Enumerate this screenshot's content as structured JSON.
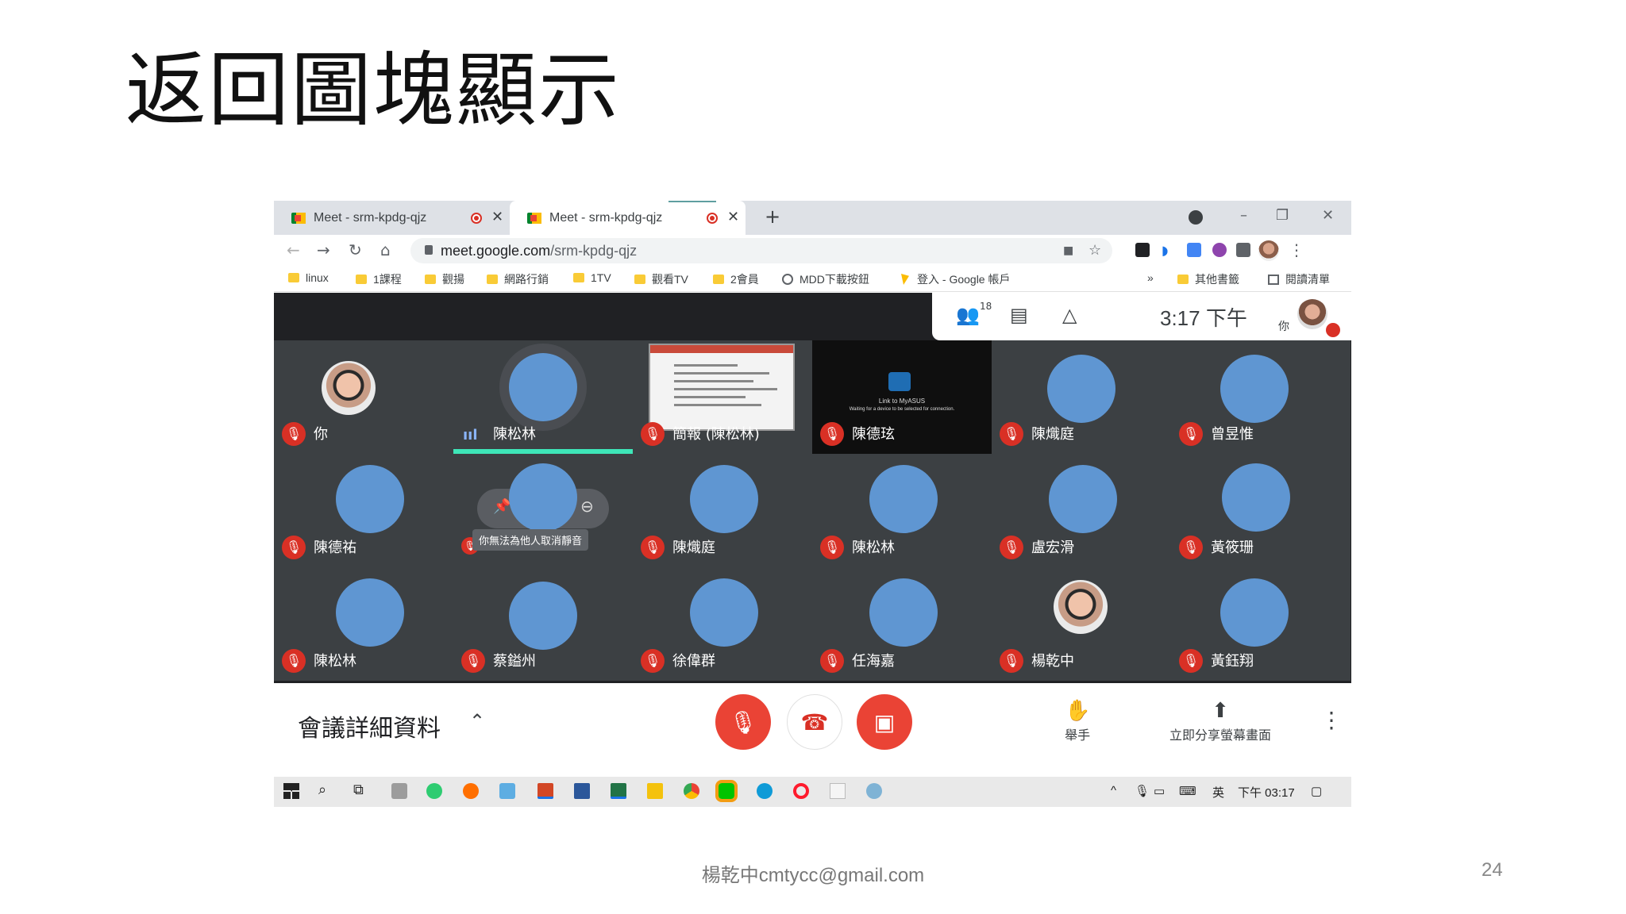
{
  "slide": {
    "title": "返回圖塊顯示",
    "footer": "楊乾中cmtycc@gmail.com",
    "page_number": "24"
  },
  "browser": {
    "tabs": [
      {
        "label": "Meet - srm-kpdg-qjz",
        "recording": true
      },
      {
        "label": "Meet - srm-kpdg-qjz",
        "recording": true,
        "active": true
      }
    ],
    "new_tab": "+",
    "window_controls": {
      "minimize": "–",
      "restore": "❐",
      "close": "✕"
    },
    "url_host": "meet.google.com",
    "url_path": "/srm-kpdg-qjz",
    "bookmarks": [
      {
        "label": "linux",
        "icon": "folder-icon"
      },
      {
        "label": "1課程",
        "icon": "folder-icon"
      },
      {
        "label": "觀揚",
        "icon": "folder-icon"
      },
      {
        "label": "網路行銷",
        "icon": "folder-icon"
      },
      {
        "label": "1TV",
        "icon": "folder-icon"
      },
      {
        "label": "觀看TV",
        "icon": "folder-icon"
      },
      {
        "label": "2會員",
        "icon": "folder-icon"
      },
      {
        "label": "MDD下載按鈕",
        "icon": "globe-icon"
      },
      {
        "label": "登入 - Google 帳戶",
        "icon": "google-ads-icon"
      }
    ],
    "bookmarks_overflow": "»",
    "other_bookmarks": "其他書籤",
    "reading_list": "閱讀清單"
  },
  "meet": {
    "participant_count": "18",
    "clock": "3:17 下午",
    "self_label": "你",
    "tiles": [
      {
        "name": "你",
        "type": "photo"
      },
      {
        "name": "陳松林",
        "type": "speaking"
      },
      {
        "name": "簡報 (陳松林)",
        "type": "screenshare"
      },
      {
        "name": "陳德玹",
        "type": "myasus"
      },
      {
        "name": "陳熾庭",
        "type": "bubble"
      },
      {
        "name": "曾昱惟",
        "type": "bubble"
      },
      {
        "name": "陳德祐",
        "type": "bubble"
      },
      {
        "name": "",
        "type": "pinned",
        "tooltip": "你無法為他人取消靜音"
      },
      {
        "name": "陳熾庭",
        "type": "bubble"
      },
      {
        "name": "陳松林",
        "type": "bubble"
      },
      {
        "name": "盧宏滑",
        "type": "bubble"
      },
      {
        "name": "黃筱珊",
        "type": "bubble"
      },
      {
        "name": "陳松林",
        "type": "bubble"
      },
      {
        "name": "蔡鎰州",
        "type": "bubble"
      },
      {
        "name": "徐偉群",
        "type": "bubble"
      },
      {
        "name": "任海嘉",
        "type": "bubble"
      },
      {
        "name": "楊乾中",
        "type": "photo"
      },
      {
        "name": "黃鈺翔",
        "type": "bubble"
      }
    ],
    "myasus_text": "Link to MyASUS",
    "myasus_sub": "Waiting for a device to be selected for connection."
  },
  "controls": {
    "meeting_details": "會議詳細資料",
    "raise_hand": "舉手",
    "present_now": "立即分享螢幕畫面"
  },
  "taskbar": {
    "ime": "英",
    "time": "下午 03:17"
  },
  "colors": {
    "meet_bg": "#202124",
    "tile_bg": "#3c4043",
    "bubble": "#5f96d2",
    "mute_red": "#d93025",
    "speaking_bar": "#3ee6b8"
  }
}
